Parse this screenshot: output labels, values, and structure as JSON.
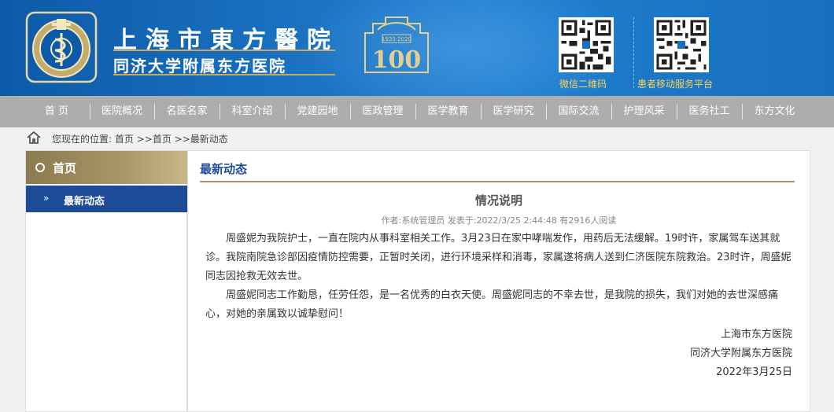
{
  "header": {
    "site_name_cn": "上海市東方醫院",
    "site_sub_cn": "同济大学附属东方医院",
    "anniversary_years": "1920-2020",
    "anniversary_number": "100",
    "qr": [
      {
        "label": "微信二维码"
      },
      {
        "label": "患者移动服务平台"
      }
    ]
  },
  "nav": {
    "items": [
      "首 页",
      "医院概况",
      "名医名家",
      "科室介绍",
      "党建园地",
      "医政管理",
      "医学教育",
      "医学研究",
      "国际交流",
      "护理风采",
      "医务社工",
      "东方文化"
    ]
  },
  "breadcrumb": {
    "prefix": "您现在的位置:",
    "link1": "首页",
    "sep": " >>",
    "link2": "首页",
    "link3": "最新动态"
  },
  "sidebar": {
    "title": "首页",
    "current": "最新动态"
  },
  "main": {
    "page_title": "最新动态",
    "article": {
      "title": "情况说明",
      "meta": "作者:系统管理员 发表于:2022/3/25 2:44:48 有2916人阅读",
      "paragraphs": [
        "周盛妮为我院护士，一直在院内从事科室相关工作。3月23日在家中哮喘发作，用药后无法缓解。19时许，家属驾车送其就诊。我院南院急诊部因疫情防控需要，正暂时关闭，进行环境采样和消毒，家属遂将病人送到仁济医院东院救治。23时许，周盛妮同志因抢救无效去世。",
        "周盛妮同志工作勤恳，任劳任怨，是一名优秀的白衣天使。周盛妮同志的不幸去世，是我院的损失，我们对她的去世深感痛心，对她的亲属致以诚挚慰问！"
      ],
      "signature": [
        "上海市东方医院",
        "同济大学附属东方医院",
        "2022年3月25日"
      ]
    }
  },
  "colors": {
    "header_blue": "#1d78c7",
    "nav_gray": "#adadad",
    "gold": "#a8976a",
    "active_blue": "#1d4b98",
    "qr_label": "#ffd35a"
  }
}
